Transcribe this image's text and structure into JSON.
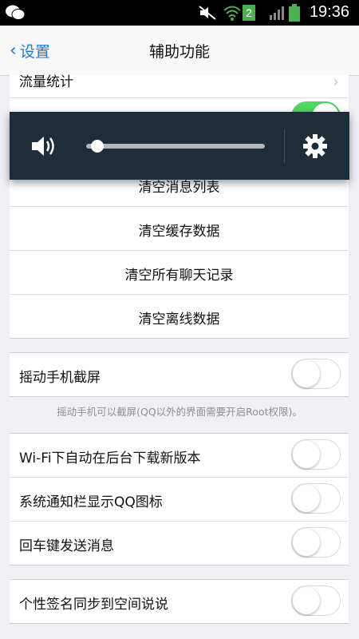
{
  "status_bar": {
    "time": "19:36",
    "sim_badge": "2",
    "icons": [
      "wechat-icon",
      "mute-icon",
      "wifi-icon",
      "sim-icon",
      "signal-icon",
      "battery-icon"
    ]
  },
  "nav": {
    "back_label": "设置",
    "title": "辅助功能"
  },
  "list_top": {
    "partial_row_label": "流量统计",
    "partial_toggle_on": true
  },
  "clear_section": {
    "items": [
      {
        "label": "清空消息列表"
      },
      {
        "label": "清空缓存数据"
      },
      {
        "label": "清空所有聊天记录"
      },
      {
        "label": "清空离线数据"
      }
    ]
  },
  "shake_section": {
    "label": "摇动手机截屏",
    "toggle_on": false,
    "hint": "摇动手机可以截屏(QQ以外的界面需要开启Root权限)。"
  },
  "settings_section": {
    "items": [
      {
        "label": "Wi-Fi下自动在后台下载新版本",
        "toggle_on": false
      },
      {
        "label": "系统通知栏显示QQ图标",
        "toggle_on": false
      },
      {
        "label": "回车键发送消息",
        "toggle_on": false
      }
    ]
  },
  "signature_section": {
    "label": "个性签名同步到空间说说",
    "toggle_on": false
  },
  "volume_overlay": {
    "level": 0.0,
    "icons": [
      "speaker-icon",
      "gear-icon"
    ]
  },
  "colors": {
    "accent": "#1f7ae0",
    "toggle_on": "#4cd964",
    "overlay_bg": "#1f2d3a",
    "page_bg": "#efeff4"
  }
}
